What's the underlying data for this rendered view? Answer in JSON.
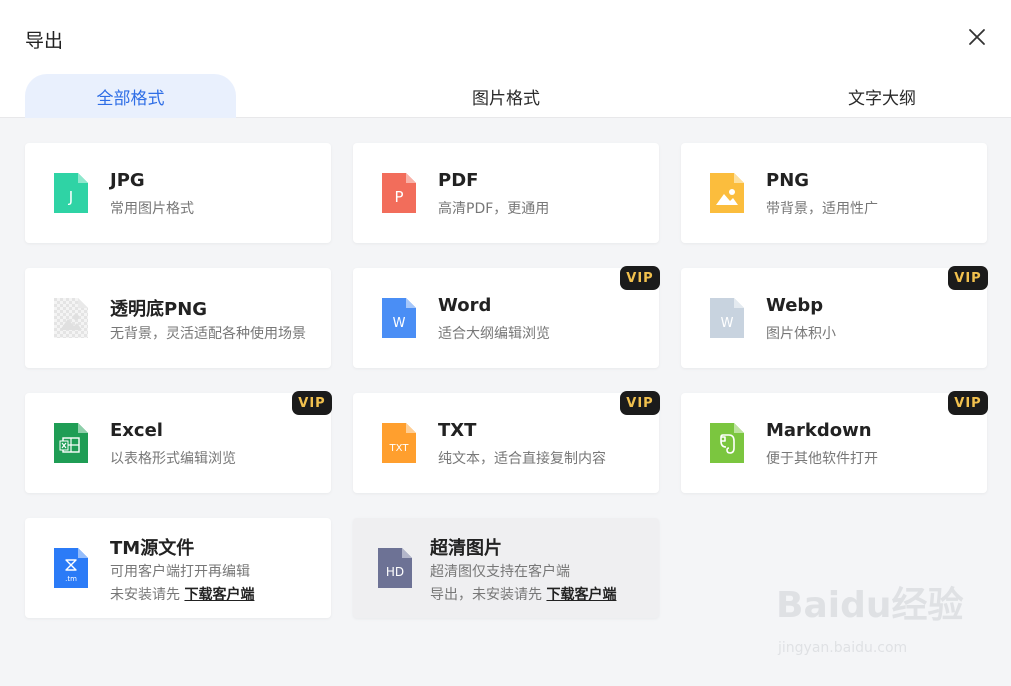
{
  "dialog": {
    "title": "导出"
  },
  "tabs": [
    {
      "label": "全部格式",
      "active": true
    },
    {
      "label": "图片格式",
      "active": false
    },
    {
      "label": "文字大纲",
      "active": false
    }
  ],
  "cards": {
    "jpg": {
      "name": "JPG",
      "desc": "常用图片格式",
      "icon": "jpg-file-icon",
      "icon_letter": "J",
      "color": "#2fd3a5"
    },
    "pdf": {
      "name": "PDF",
      "desc": "高清PDF，更通用",
      "icon": "pdf-file-icon",
      "icon_letter": "P",
      "color": "#f26d5b"
    },
    "png": {
      "name": "PNG",
      "desc": "带背景，适用性广",
      "icon": "png-file-icon",
      "color": "#fbbd3d"
    },
    "transparent_png": {
      "name": "透明底PNG",
      "desc": "无背景，灵活适配各种使用场景",
      "icon": "transparent-png-file-icon"
    },
    "word": {
      "name": "Word",
      "desc": "适合大纲编辑浏览",
      "icon": "word-file-icon",
      "icon_letter": "W",
      "color": "#4a8ef5",
      "vip": "VIP"
    },
    "webp": {
      "name": "Webp",
      "desc": "图片体积小",
      "icon": "webp-file-icon",
      "icon_letter": "W",
      "color": "#c8d3df",
      "vip": "VIP"
    },
    "excel": {
      "name": "Excel",
      "desc": "以表格形式编辑浏览",
      "icon": "excel-file-icon",
      "color": "#1f9d55",
      "vip": "VIP"
    },
    "txt": {
      "name": "TXT",
      "desc": "纯文本，适合直接复制内容",
      "icon": "txt-file-icon",
      "icon_letter": "TXT",
      "color": "#ff9f2e",
      "vip": "VIP"
    },
    "markdown": {
      "name": "Markdown",
      "desc": "便于其他软件打开",
      "icon": "evernote-file-icon",
      "color": "#7bc63f",
      "vip": "VIP"
    },
    "tm": {
      "name": "TM源文件",
      "desc": "可用客户端打开再编辑",
      "desc2_prefix": "未安装请先",
      "download_link": "下载客户端",
      "icon": "tm-file-icon",
      "icon_letter": ".tm",
      "color": "#2b7bf7"
    },
    "hd": {
      "name": "超清图片",
      "desc": "超清图仅支持在客户端",
      "desc2_prefix": "导出，未安装请先",
      "download_link": "下载客户端",
      "icon": "hd-file-icon",
      "icon_letter": "HD",
      "color": "#6d7295"
    }
  },
  "watermark": {
    "brand": "Baidu经验",
    "url": "jingyan.baidu.com"
  }
}
